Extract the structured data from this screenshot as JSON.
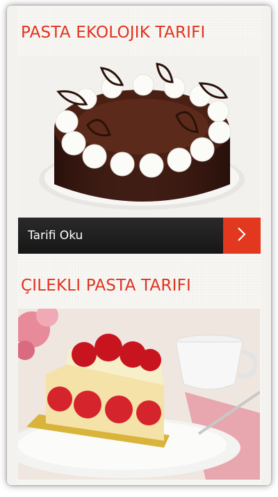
{
  "recipes": [
    {
      "title": "PASTA EKOLOJIK TARIFI",
      "button_label": "Tarifi Oku",
      "image_icon": "chocolate-cake-image"
    },
    {
      "title": "ÇILEKLI PASTA TARIFI",
      "image_icon": "strawberry-cake-image"
    }
  ],
  "colors": {
    "accent": "#e0331e",
    "bar": "#1e1e1e",
    "arrow_bg": "#e2381f"
  },
  "icons": {
    "arrow": "chevron-right-icon"
  }
}
